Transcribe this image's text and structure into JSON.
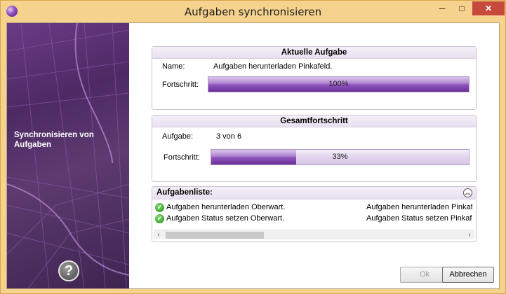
{
  "window": {
    "title": "Aufgaben synchronisieren",
    "minimize": "─",
    "maximize": "□",
    "close": "✕"
  },
  "sidebar": {
    "title": "Synchronisieren von Aufgaben",
    "help": "?"
  },
  "current_task": {
    "header": "Aktuelle Aufgabe",
    "name_label": "Name:",
    "name_value": "Aufgaben herunterladen Pinkafeld.",
    "progress_label": "Fortschritt:",
    "progress_text": "100%",
    "progress_fraction": 1.0
  },
  "overall": {
    "header": "Gesamtfortschritt",
    "task_label": "Aufgabe:",
    "task_value": "3 von 6",
    "progress_label": "Fortschritt:",
    "progress_text": "33%",
    "progress_fraction": 0.33
  },
  "task_list": {
    "title": "Aufgabenliste:",
    "rows": [
      {
        "text": "Aufgaben herunterladen Oberwart.",
        "right": "Aufgaben herunterladen Pinkafe"
      },
      {
        "text": "Aufgaben Status setzen Oberwart.",
        "right": "Aufgaben Status setzen Pinkafe"
      }
    ]
  },
  "buttons": {
    "ok": "Ok",
    "cancel": "Abbrechen"
  },
  "colors": {
    "titlebar": "#f5d28d",
    "accent_purple": "#8e52bd",
    "close_red": "#c7493b"
  }
}
